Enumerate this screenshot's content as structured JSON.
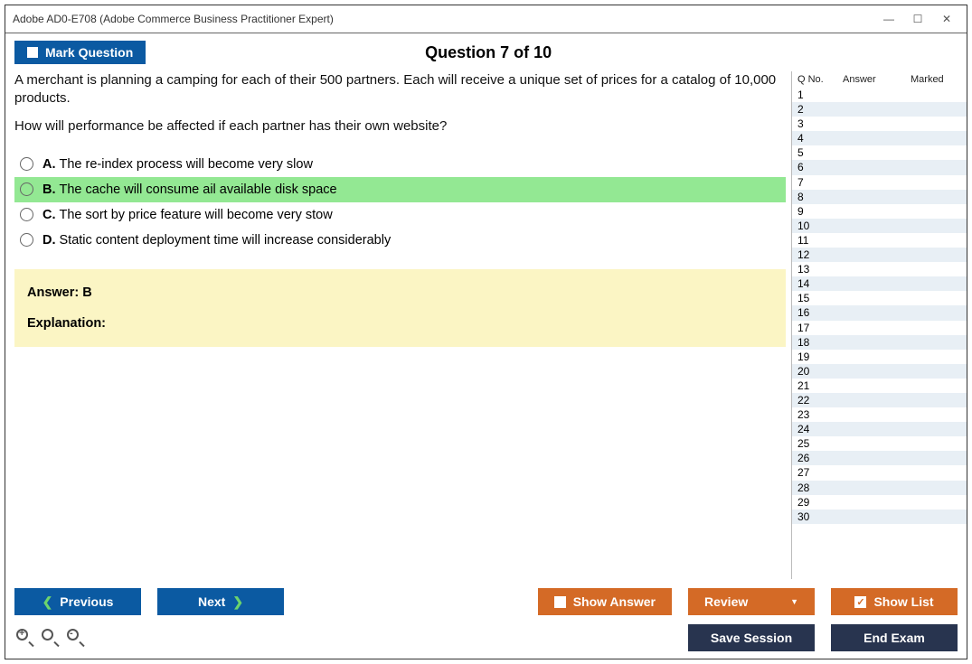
{
  "window": {
    "title": "Adobe AD0-E708 (Adobe Commerce Business Practitioner Expert)"
  },
  "header": {
    "mark_label": "Mark Question",
    "question_title": "Question 7 of 10"
  },
  "question": {
    "text1": "A merchant is planning a camping for each of their 500 partners. Each will receive a unique set of prices for a catalog of 10,000 products.",
    "text2": "How will performance be affected if each partner has their own website?",
    "options": [
      {
        "letter": "A.",
        "text": "The re-index process will become very slow",
        "highlight": false
      },
      {
        "letter": "B.",
        "text": "The cache will consume ail available disk space",
        "highlight": true
      },
      {
        "letter": "C.",
        "text": "The sort by price feature will become very stow",
        "highlight": false
      },
      {
        "letter": "D.",
        "text": "Static content deployment time will increase considerably",
        "highlight": false
      }
    ]
  },
  "answer": {
    "label": "Answer: B",
    "explanation_label": "Explanation:"
  },
  "side": {
    "col1": "Q No.",
    "col2": "Answer",
    "col3": "Marked",
    "count": 30
  },
  "buttons": {
    "previous": "Previous",
    "next": "Next",
    "show_answer": "Show Answer",
    "review": "Review",
    "show_list": "Show List",
    "save_session": "Save Session",
    "end_exam": "End Exam"
  }
}
